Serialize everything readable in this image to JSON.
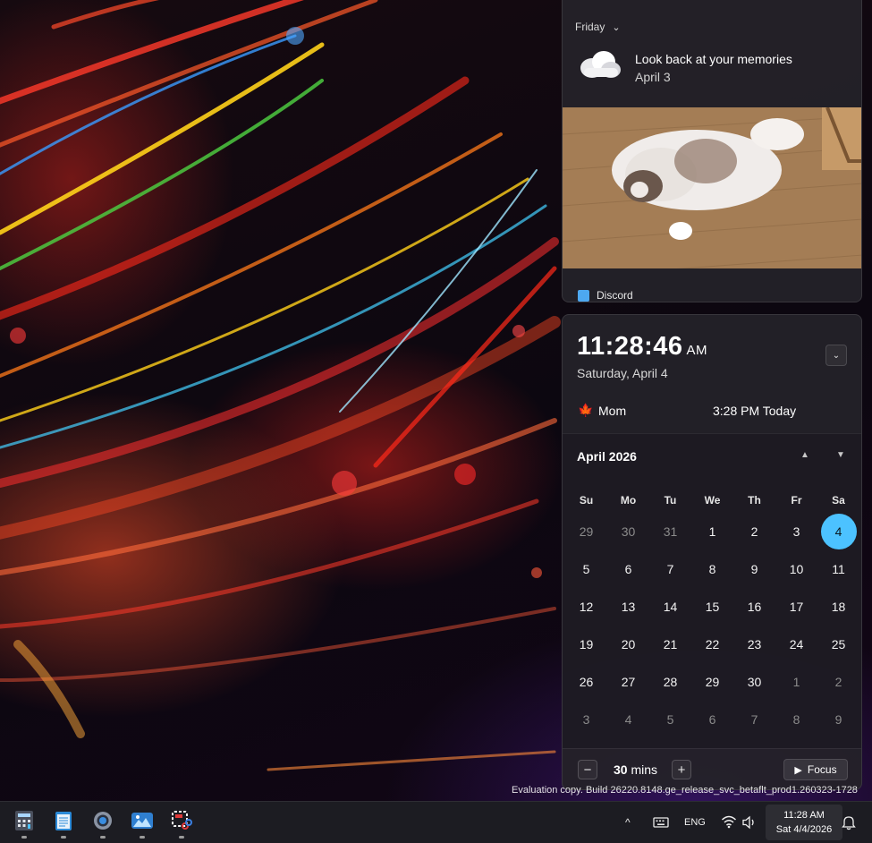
{
  "notification": {
    "header": "Friday",
    "title": "Look back at your memories",
    "date": "April 3",
    "source_app": "Discord"
  },
  "clock": {
    "time": "11:28:46",
    "ampm": "AM",
    "date": "Saturday, April 4"
  },
  "event": {
    "name": "Mom",
    "time": "3:28 PM Today"
  },
  "calendar": {
    "month_label": "April 2026",
    "weekdays": [
      "Su",
      "Mo",
      "Tu",
      "We",
      "Th",
      "Fr",
      "Sa"
    ],
    "days": [
      {
        "n": "29",
        "muted": true
      },
      {
        "n": "30",
        "muted": true
      },
      {
        "n": "31",
        "muted": true
      },
      {
        "n": "1"
      },
      {
        "n": "2"
      },
      {
        "n": "3"
      },
      {
        "n": "4",
        "today": true
      },
      {
        "n": "5"
      },
      {
        "n": "6"
      },
      {
        "n": "7"
      },
      {
        "n": "8"
      },
      {
        "n": "9"
      },
      {
        "n": "10"
      },
      {
        "n": "11"
      },
      {
        "n": "12"
      },
      {
        "n": "13"
      },
      {
        "n": "14"
      },
      {
        "n": "15"
      },
      {
        "n": "16"
      },
      {
        "n": "17"
      },
      {
        "n": "18"
      },
      {
        "n": "19"
      },
      {
        "n": "20"
      },
      {
        "n": "21"
      },
      {
        "n": "22"
      },
      {
        "n": "23"
      },
      {
        "n": "24"
      },
      {
        "n": "25"
      },
      {
        "n": "26"
      },
      {
        "n": "27"
      },
      {
        "n": "28"
      },
      {
        "n": "29"
      },
      {
        "n": "30"
      },
      {
        "n": "1",
        "muted": true
      },
      {
        "n": "2",
        "muted": true
      },
      {
        "n": "3",
        "muted": true
      },
      {
        "n": "4",
        "muted": true
      },
      {
        "n": "5",
        "muted": true
      },
      {
        "n": "6",
        "muted": true
      },
      {
        "n": "7",
        "muted": true
      },
      {
        "n": "8",
        "muted": true
      },
      {
        "n": "9",
        "muted": true
      }
    ],
    "accent_color": "#4cc2ff"
  },
  "focus": {
    "minutes": "30",
    "unit": "mins",
    "button_label": "Focus"
  },
  "watermark": "Evaluation copy. Build 26220.8148.ge_release_svc_betaflt_prod1.260323-1728",
  "taskbar": {
    "apps": [
      {
        "name": "calculator-icon"
      },
      {
        "name": "notepad-icon"
      },
      {
        "name": "settings-icon"
      },
      {
        "name": "photos-icon"
      },
      {
        "name": "snipping-tool-icon"
      }
    ],
    "language": "ENG",
    "time": "11:28 AM",
    "date": "Sat 4/4/2026"
  }
}
